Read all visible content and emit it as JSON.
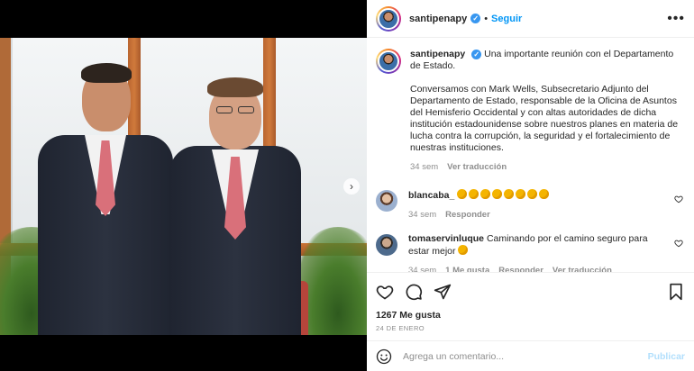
{
  "post": {
    "username": "santipenapy",
    "verified_mark": "✓",
    "separator": "•",
    "follow_label": "Seguir",
    "more_label": "•••",
    "caption_lead": "Una importante reunión con el Departamento de Estado.",
    "caption_body": "Conversamos con Mark Wells, Subsecretario Adjunto del Departamento de Estado, responsable de la Oficina de Asuntos del Hemisferio Occidental y con altas autoridades de dicha institución estadounidense sobre nuestros planes en materia de lucha contra la corrupción, la seguridad y el fortalecimiento de nuestras instituciones.",
    "caption_age": "34 sem",
    "caption_translate": "Ver traducción"
  },
  "comments": [
    {
      "username": "blancaba_",
      "text": "",
      "clap_count": 8,
      "age": "34 sem",
      "actions": [
        "Responder"
      ]
    },
    {
      "username": "tomaservinluque",
      "text": "Caminando por el camino seguro para estar mejor",
      "clap_count": 1,
      "age": "34 sem",
      "actions": [
        "1 Me gusta",
        "Responder",
        "Ver traducción"
      ]
    }
  ],
  "actions": {
    "icons": [
      "heart-icon",
      "comment-icon",
      "share-icon",
      "bookmark-icon"
    ],
    "likes": "1267 Me gusta",
    "date": "24 DE ENERO"
  },
  "add_comment": {
    "placeholder": "Agrega un comentario...",
    "publish_label": "Publicar"
  },
  "media": {
    "next_label": "›",
    "page_count": 2,
    "current_page": 1
  },
  "colors": {
    "accent": "#0095f6",
    "verified": "#3897f0",
    "muted": "#8e8e8e",
    "publish_disabled": "#b2dffc"
  }
}
